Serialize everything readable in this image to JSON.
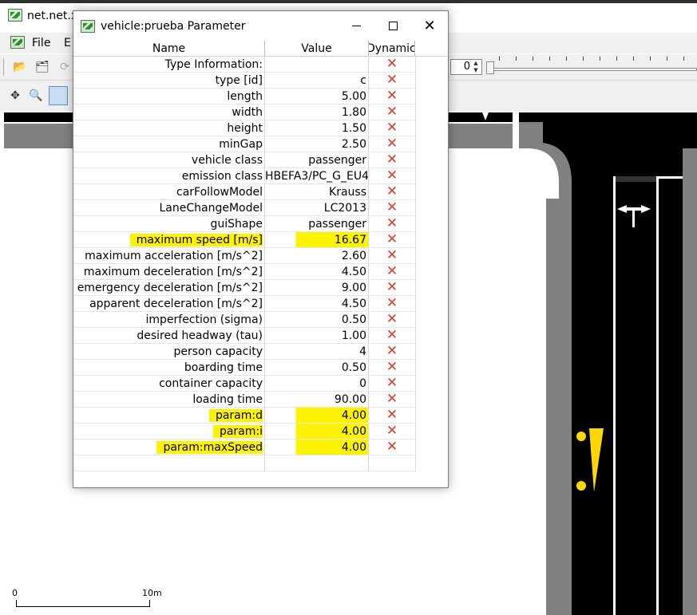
{
  "main_window": {
    "title": "net.net.x",
    "menu": {
      "file": "File",
      "edit": "E"
    },
    "time_value": "0"
  },
  "scale_bar": {
    "zero": "0",
    "ten": "10m"
  },
  "dialog": {
    "title": "vehicle:prueba Parameter",
    "columns": {
      "name": "Name",
      "value": "Value",
      "dynamic": "Dynamic"
    },
    "rows": [
      {
        "name": "Type Information:",
        "value": "",
        "dynamic": "✕",
        "highlight": false
      },
      {
        "name": "type [id]",
        "value": "c",
        "dynamic": "✕",
        "highlight": false
      },
      {
        "name": "length",
        "value": "5.00",
        "dynamic": "✕",
        "highlight": false
      },
      {
        "name": "width",
        "value": "1.80",
        "dynamic": "✕",
        "highlight": false
      },
      {
        "name": "height",
        "value": "1.50",
        "dynamic": "✕",
        "highlight": false
      },
      {
        "name": "minGap",
        "value": "2.50",
        "dynamic": "✕",
        "highlight": false
      },
      {
        "name": "vehicle class",
        "value": "passenger",
        "dynamic": "✕",
        "highlight": false
      },
      {
        "name": "emission class",
        "value": "HBEFA3/PC_G_EU4",
        "dynamic": "✕",
        "highlight": false
      },
      {
        "name": "carFollowModel",
        "value": "Krauss",
        "dynamic": "✕",
        "highlight": false
      },
      {
        "name": "LaneChangeModel",
        "value": "LC2013",
        "dynamic": "✕",
        "highlight": false
      },
      {
        "name": "guiShape",
        "value": "passenger",
        "dynamic": "✕",
        "highlight": false
      },
      {
        "name": "maximum speed [m/s]",
        "value": "16.67",
        "dynamic": "✕",
        "highlight": true
      },
      {
        "name": "maximum acceleration [m/s^2]",
        "value": "2.60",
        "dynamic": "✕",
        "highlight": false
      },
      {
        "name": "maximum deceleration [m/s^2]",
        "value": "4.50",
        "dynamic": "✕",
        "highlight": false
      },
      {
        "name": "emergency deceleration [m/s^2]",
        "value": "9.00",
        "dynamic": "✕",
        "highlight": false
      },
      {
        "name": "apparent deceleration [m/s^2]",
        "value": "4.50",
        "dynamic": "✕",
        "highlight": false
      },
      {
        "name": "imperfection (sigma)",
        "value": "0.50",
        "dynamic": "✕",
        "highlight": false
      },
      {
        "name": "desired headway (tau)",
        "value": "1.00",
        "dynamic": "✕",
        "highlight": false
      },
      {
        "name": "person capacity",
        "value": "4",
        "dynamic": "✕",
        "highlight": false
      },
      {
        "name": "boarding time",
        "value": "0.50",
        "dynamic": "✕",
        "highlight": false
      },
      {
        "name": "container capacity",
        "value": "0",
        "dynamic": "✕",
        "highlight": false
      },
      {
        "name": "loading time",
        "value": "90.00",
        "dynamic": "✕",
        "highlight": false
      },
      {
        "name": "param:d",
        "value": "4.00",
        "dynamic": "✕",
        "highlight": true
      },
      {
        "name": "param:i",
        "value": "4.00",
        "dynamic": "✕",
        "highlight": true
      },
      {
        "name": "param:maxSpeed",
        "value": "4.00",
        "dynamic": "✕",
        "highlight": true
      }
    ]
  },
  "colors": {
    "highlight": "#fdf300",
    "dynamic_x": "#e03a2a",
    "road": "#000000",
    "curb": "#808080",
    "vehicle": "#ffd700"
  }
}
